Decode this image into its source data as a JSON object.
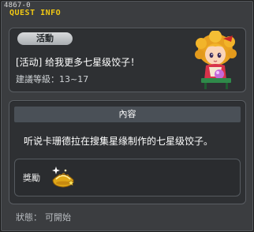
{
  "window": {
    "quest_id": "4867-0",
    "title": "QUEST INFO"
  },
  "header": {
    "tag": "活動",
    "quest_name": "[活动] 给我更多七星级饺子！",
    "level_label": "建議等級：",
    "level_range": "13~17"
  },
  "content": {
    "heading": "內容",
    "description": "听说卡珊德拉在搜集星缘制作的七星级饺子。",
    "reward_label": "獎勵"
  },
  "status": {
    "label": "狀態：",
    "value": "可開始"
  },
  "icons": {
    "npc": "npc-portrait-icon",
    "reward": "golden-dumpling-icon"
  },
  "colors": {
    "title": "#f0c814",
    "background": "#3b3d40",
    "panel": "#2e3033"
  }
}
